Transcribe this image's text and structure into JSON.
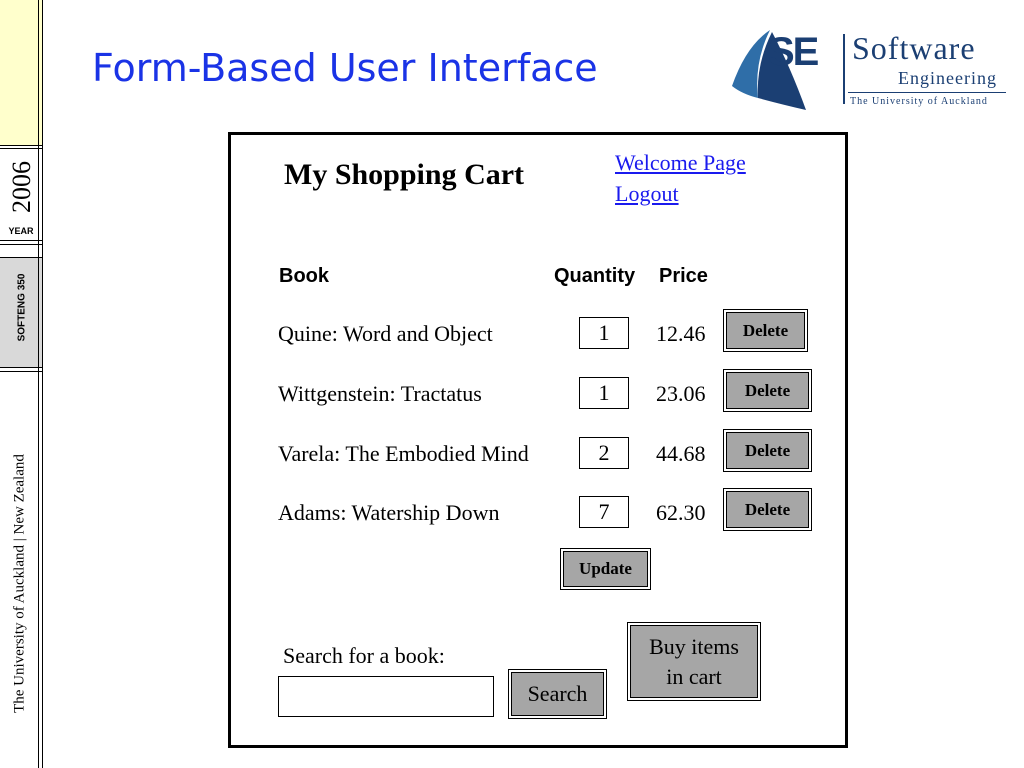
{
  "slide": {
    "title": "Form-Based User Interface",
    "sidebar": {
      "year": "2006",
      "year_label": "YEAR",
      "course": "SOFTENG 350",
      "university": "The University of Auckland | New Zealand"
    },
    "logo": {
      "mark": "SE",
      "line1": "Software",
      "line2": "Engineering",
      "line3": "The University of Auckland",
      "color": "#1b3f73"
    },
    "title_color": "#1a33e6"
  },
  "cart": {
    "title": "My Shopping Cart",
    "links": {
      "welcome": "Welcome Page",
      "logout": "Logout"
    },
    "headers": {
      "book": "Book",
      "quantity": "Quantity",
      "price": "Price"
    },
    "rows": [
      {
        "title": "Quine: Word and Object",
        "quantity": "1",
        "price": "12.46",
        "action": "Delete"
      },
      {
        "title": "Wittgenstein: Tractatus",
        "quantity": "1",
        "price": "23.06",
        "action": "Delete"
      },
      {
        "title": "Varela: The Embodied Mind",
        "quantity": "2",
        "price": "44.68",
        "action": "Delete"
      },
      {
        "title": "Adams: Watership Down",
        "quantity": "7",
        "price": "62.30",
        "action": "Delete"
      }
    ],
    "update_label": "Update",
    "search_label": "Search for a book:",
    "search_value": "",
    "search_button": "Search",
    "buy_button_line1": "Buy items",
    "buy_button_line2": "in cart",
    "button_color": "#a6a6a6",
    "link_color": "#1a1aee"
  }
}
